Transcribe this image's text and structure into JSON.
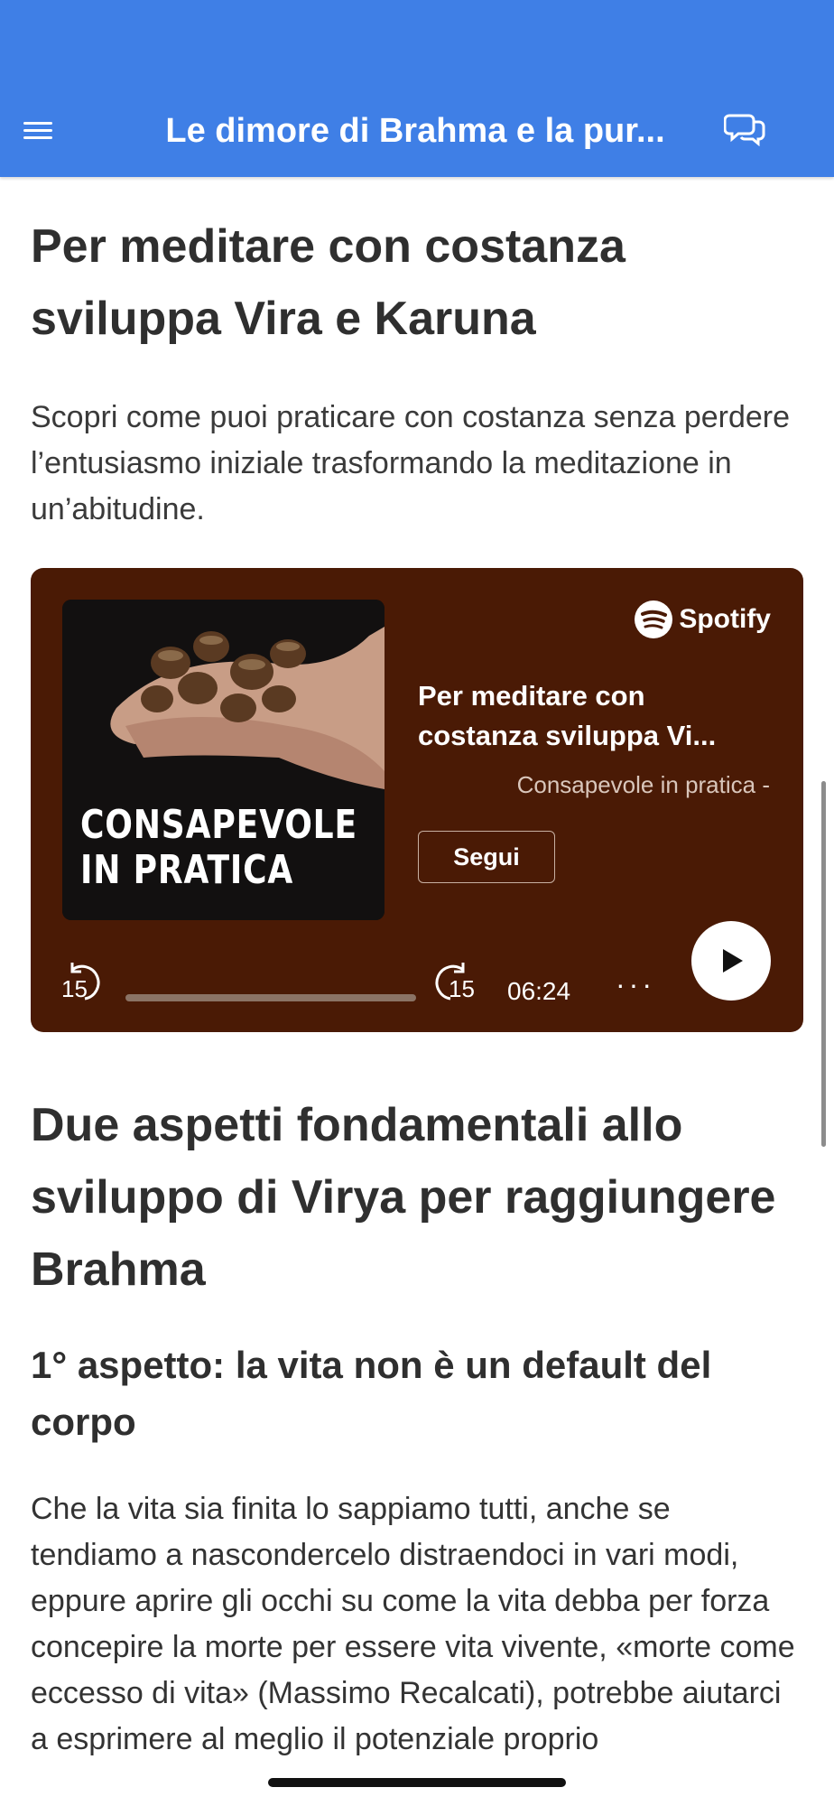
{
  "nav": {
    "title": "Le dimore di Brahma e la pur..."
  },
  "article": {
    "heading1": "Per meditare con costanza sviluppa Vira e Karuna",
    "lead": "Scopri come puoi praticare con costanza senza perdere l’entusiasmo iniziale trasformando la meditazione in un’abitudine.",
    "heading2": "Due aspetti fondamentali allo sviluppo di Virya per raggiungere Brahma",
    "heading3": "1° aspetto: la vita non è un default del corpo",
    "paragraph": "Che la vita sia finita lo sappiamo tutti, anche se tendiamo a nascondercelo distraendoci in vari modi, eppure aprire gli occhi su come la vita debba per forza concepire la morte per essere vita vivente, «morte come eccesso di vita» (Massimo Recalcati), potrebbe aiutarci a esprimere al meglio il potenziale proprio"
  },
  "player": {
    "brand": "Spotify",
    "cover_line1": "CONSAPEVOLE",
    "cover_line2": "IN PRATICA",
    "episode_title": "Per meditare con costanza sviluppa Vi...",
    "show_name": "Consapevole in pratica -",
    "follow_label": "Segui",
    "skip_back_label": "15",
    "skip_forward_label": "15",
    "time": "06:24",
    "more_label": "···",
    "progress": 0.0,
    "bg_color": "#4a1a05"
  },
  "colors": {
    "header": "#3f7fe6"
  },
  "icons": {
    "menu": "hamburger-icon",
    "chat": "chat-bubbles-icon",
    "play": "play-icon"
  }
}
